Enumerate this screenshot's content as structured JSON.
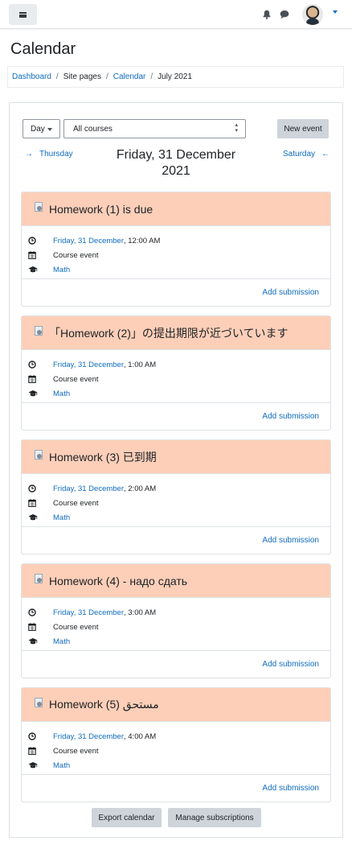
{
  "nav": {
    "menu_icon": "hamburger-icon",
    "notification_icon": "bell-icon",
    "message_icon": "chat-icon"
  },
  "page_title": "Calendar",
  "breadcrumb": [
    "Dashboard",
    "Site pages",
    "Calendar",
    "July 2021"
  ],
  "toolbar": {
    "view": "Day",
    "course": "All courses",
    "new_event": "New event"
  },
  "day_nav": {
    "prev": "Thursday",
    "next": "Saturday",
    "title_line1": "Friday, 31 December",
    "title_line2": "2021"
  },
  "events": [
    {
      "title": "Homework (1) is due",
      "date": "Friday, 31 December",
      "time": ", 12:00 AM",
      "type": "Course event",
      "course": "Math",
      "action": "Add submission"
    },
    {
      "title": "「Homework (2)」の提出期限が近づいています",
      "date": "Friday, 31 December",
      "time": ", 1:00 AM",
      "type": "Course event",
      "course": "Math",
      "action": "Add submission"
    },
    {
      "title": "Homework (3) 已到期",
      "date": "Friday, 31 December",
      "time": ", 2:00 AM",
      "type": "Course event",
      "course": "Math",
      "action": "Add submission"
    },
    {
      "title": "Homework (4) - надо сдать",
      "date": "Friday, 31 December",
      "time": ", 3:00 AM",
      "type": "Course event",
      "course": "Math",
      "action": "Add submission"
    },
    {
      "title": "Homework (5) مستحق",
      "date": "Friday, 31 December",
      "time": ", 4:00 AM",
      "type": "Course event",
      "course": "Math",
      "action": "Add submission"
    }
  ],
  "footer": {
    "export": "Export calendar",
    "manage": "Manage subscriptions"
  }
}
